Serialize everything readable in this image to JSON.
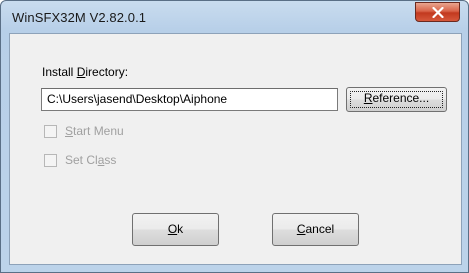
{
  "window": {
    "title": "WinSFX32M V2.82.0.1"
  },
  "form": {
    "install_dir_label_pre": "Install ",
    "install_dir_label_mnemonic": "D",
    "install_dir_label_post": "irectory:",
    "install_dir_value": "C:\\Users\\jasend\\Desktop\\Aiphone",
    "reference_mnemonic": "R",
    "reference_rest": "eference...",
    "options": [
      {
        "pre": "",
        "mnemonic": "S",
        "post": "tart Menu",
        "checked": false,
        "enabled": false
      },
      {
        "pre": "Set Cl",
        "mnemonic": "a",
        "post": "ss",
        "checked": false,
        "enabled": false
      }
    ]
  },
  "buttons": {
    "ok_mnemonic": "O",
    "ok_rest": "k",
    "cancel_mnemonic": "C",
    "cancel_rest": "ancel"
  }
}
